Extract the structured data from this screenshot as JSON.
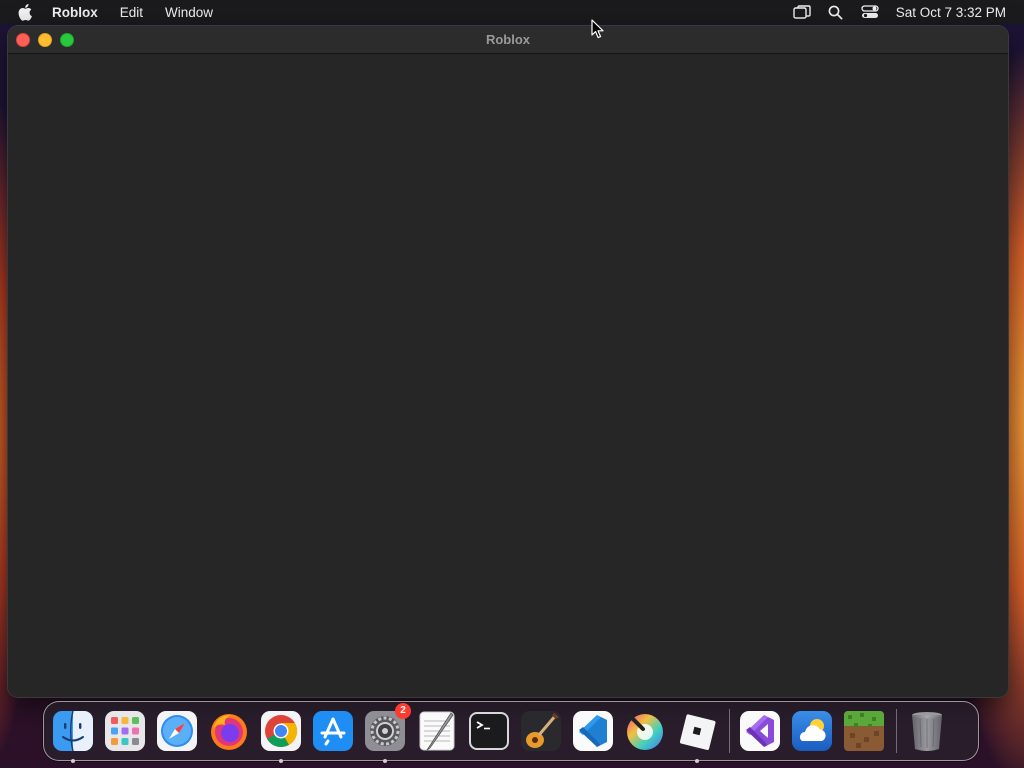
{
  "menubar": {
    "app_name": "Roblox",
    "menus": [
      "Edit",
      "Window"
    ],
    "clock": "Sat Oct 7  3:32 PM",
    "icons": [
      "apple-icon",
      "screen-mirroring-icon",
      "spotlight-search-icon",
      "control-center-icon"
    ]
  },
  "window": {
    "title": "Roblox",
    "controls": [
      "close",
      "minimize",
      "zoom"
    ],
    "colors": {
      "close": "#fe5f57",
      "minimize": "#febc2e",
      "zoom": "#28c840",
      "content": "#262626"
    }
  },
  "dock": {
    "items": [
      {
        "name": "finder-icon",
        "running": true
      },
      {
        "name": "launchpad-icon",
        "running": false
      },
      {
        "name": "safari-icon",
        "running": false
      },
      {
        "name": "firefox-icon",
        "running": false
      },
      {
        "name": "chrome-icon",
        "running": true
      },
      {
        "name": "app-store-icon",
        "running": false
      },
      {
        "name": "system-settings-icon",
        "running": true,
        "badge": "2"
      },
      {
        "name": "textedit-icon",
        "running": false
      },
      {
        "name": "terminal-icon",
        "running": false
      },
      {
        "name": "garageband-icon",
        "running": false
      },
      {
        "name": "vscode-icon",
        "running": false
      },
      {
        "name": "color-picker-icon",
        "running": false
      },
      {
        "name": "roblox-icon",
        "running": true
      },
      {
        "name": "visual-studio-icon",
        "running": false
      },
      {
        "name": "weather-icon",
        "running": false
      },
      {
        "name": "minecraft-icon",
        "running": false
      },
      {
        "name": "trash-icon",
        "running": false
      }
    ]
  }
}
